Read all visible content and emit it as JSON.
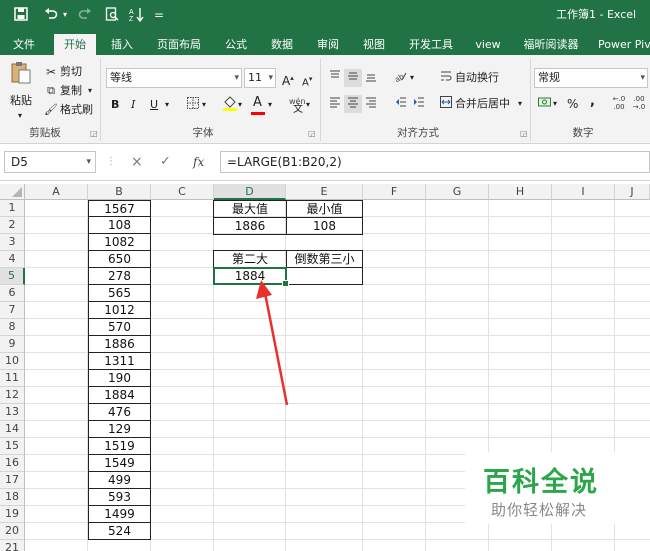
{
  "window": {
    "title": "工作簿1 - Excel"
  },
  "qat": {
    "save_icon": "save-icon",
    "undo_icon": "undo-icon",
    "redo_icon": "redo-icon",
    "preview_icon": "print-preview-icon",
    "sort_icon": "sort-icon",
    "more": "="
  },
  "tabs": [
    "文件",
    "开始",
    "插入",
    "页面布局",
    "公式",
    "数据",
    "审阅",
    "视图",
    "开发工具",
    "view",
    "福昕阅读器",
    "Power Piv"
  ],
  "ribbon": {
    "clipboard": {
      "paste": "粘贴",
      "cut": "剪切",
      "copy": "复制",
      "format_painter": "格式刷",
      "label": "剪贴板"
    },
    "font": {
      "name": "等线",
      "size": "11",
      "bold": "B",
      "italic": "I",
      "underline": "U",
      "grow": "A",
      "shrink": "A",
      "fill_color": "#FFFF00",
      "font_color": "#FF0000",
      "font_letter": "A",
      "phonetic": "wén",
      "label": "字体"
    },
    "alignment": {
      "wrap": "自动换行",
      "merge": "合并后居中",
      "label": "对齐方式"
    },
    "number": {
      "format": "常规",
      "percent": "%",
      "comma": ",",
      "label": "数字"
    }
  },
  "formula_bar": {
    "name_box": "D5",
    "cancel": "×",
    "enter": "✓",
    "fx": "fx",
    "formula": "=LARGE(B1:B20,2)"
  },
  "columns": [
    "A",
    "B",
    "C",
    "D",
    "E",
    "F",
    "G",
    "H",
    "I",
    "J"
  ],
  "rows": [
    "1",
    "2",
    "3",
    "4",
    "5",
    "6",
    "7",
    "8",
    "9",
    "10",
    "11",
    "12",
    "13",
    "14",
    "15",
    "16",
    "17",
    "18",
    "19",
    "20",
    "21"
  ],
  "column_b": [
    "1567",
    "108",
    "1082",
    "650",
    "278",
    "565",
    "1012",
    "570",
    "1886",
    "1311",
    "190",
    "1884",
    "476",
    "129",
    "1519",
    "1549",
    "499",
    "593",
    "1499",
    "524"
  ],
  "cells": {
    "d1": "最大值",
    "e1": "最小值",
    "d2": "1886",
    "e2": "108",
    "d4": "第二大",
    "e4": "倒数第三小",
    "d5": "1884"
  },
  "annotation": {
    "color": "#E8312F"
  },
  "watermark": {
    "title": "百科全说",
    "subtitle": "助你轻松解决",
    "color": "#2BA64A"
  },
  "colors": {
    "accent": "#217346"
  }
}
